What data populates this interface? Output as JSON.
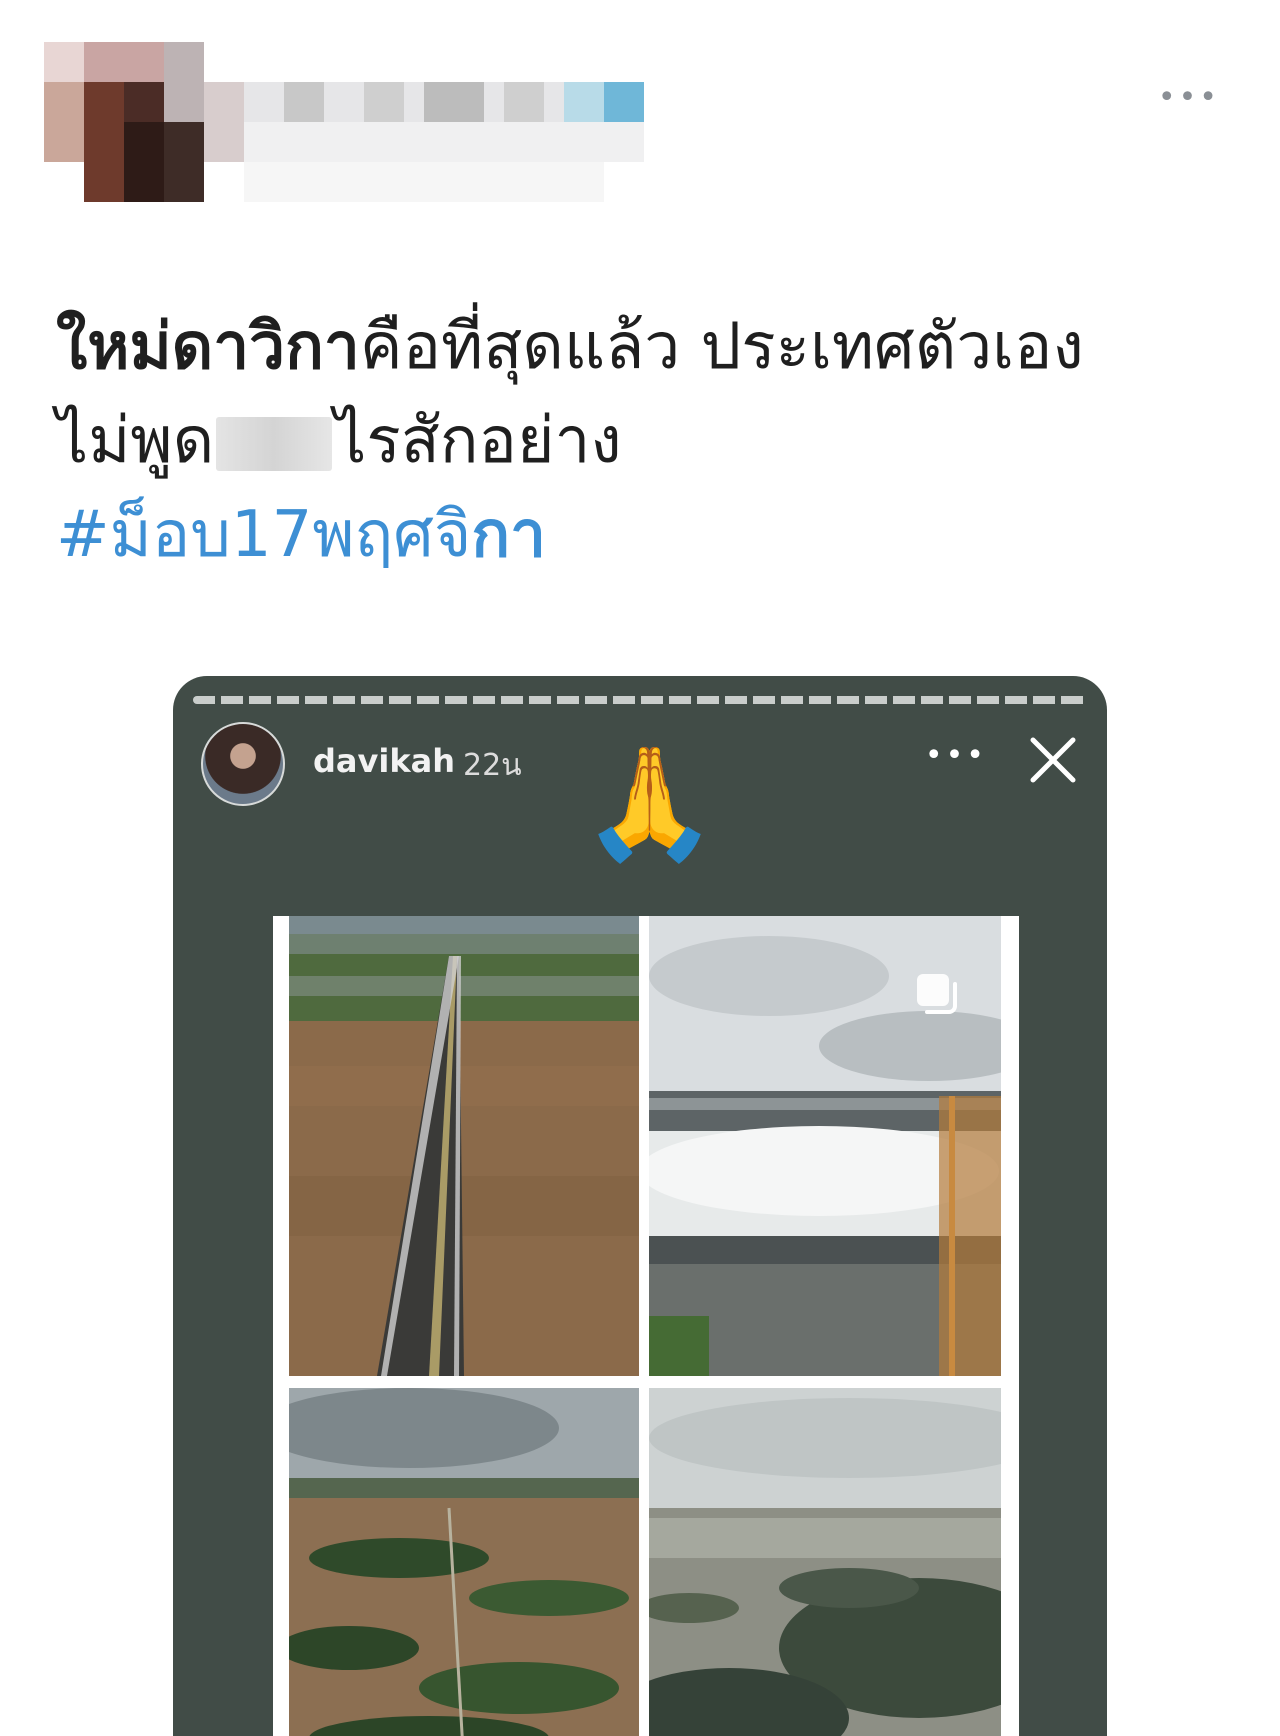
{
  "tweet": {
    "more_icon": "more-horizontal-icon",
    "text_bold": "ใหม่ดาวิกา",
    "text_line1_rest": "คือที่สุดแล้ว ประเทศตัวเอง",
    "text_line2_a": "ไม่พูด",
    "text_line2_b": "ไรสักอย่าง",
    "hashtag_main": "#ม็อบ17พฤศจิ",
    "hashtag_tail": "กา"
  },
  "story": {
    "username": "davikah",
    "time": "22น",
    "emoji": "🙏",
    "more_icon": "more-horizontal-icon",
    "close_icon": "close-icon",
    "multi_image_icon": "multiple-images-icon"
  },
  "colors": {
    "hashtag": "#3d8fd4",
    "story_bg": "#414c47",
    "text": "#1f1f1f"
  }
}
